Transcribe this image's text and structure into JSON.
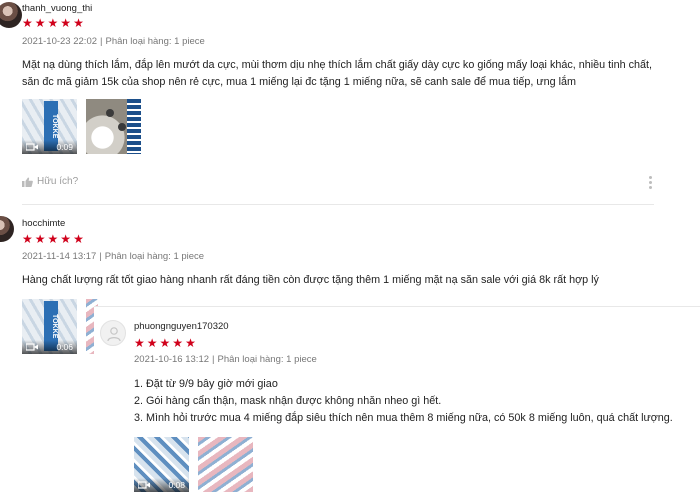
{
  "reviews": [
    {
      "username": "thanh_vuong_thi",
      "rating": 5,
      "date": "2021-10-23 22:02",
      "variation_label": "Phân loại hàng: 1 piece",
      "content": "Mặt nạ dùng thích lắm, đắp lên mướt da cực, mùi thơm dịu nhẹ thích lắm chất giấy dày cực ko giống mấy loại khác, nhiều tinh chất, săn đc mã giảm 15k của shop nên rẻ cực, mua 1 miếng lại đc tặng 1 miếng nữa, sẽ canh sale để mua tiếp, ưng lắm",
      "media": [
        {
          "type": "video",
          "duration": "0:09"
        },
        {
          "type": "image"
        }
      ],
      "helpful_label": "Hữu ích?"
    },
    {
      "username": "hocchimte",
      "rating": 5,
      "date": "2021-11-14 13:17",
      "variation_label": "Phân loại hàng: 1 piece",
      "content": "Hàng chất lượng rất tốt giao hàng nhanh rất đáng tiền còn được tặng thêm 1 miếng mặt nạ săn sale với giá 8k rất hợp lý",
      "media": [
        {
          "type": "video",
          "duration": "0:06"
        }
      ]
    },
    {
      "username": "phuongnguyen170320",
      "rating": 5,
      "date": "2021-10-16 13:12",
      "variation_label": "Phân loại hàng: 1 piece",
      "content_lines": [
        "1. Đặt từ 9/9 bây giờ mới giao",
        "2. Gói hàng cẩn thận, mask nhận được không nhăn nheo gì hết.",
        "3. Mình hỏi trước mua 4 miếng đắp siêu thích nên mua thêm 8 miếng nữa, có 50k 8 miếng luôn, quá chất lượng."
      ],
      "media": [
        {
          "type": "video",
          "duration": "0:08"
        },
        {
          "type": "image"
        }
      ]
    }
  ],
  "icons": {
    "star": "★",
    "thumbs_up": "thumbs-up-icon",
    "video": "video-camera-icon",
    "more": "more-vertical-icon"
  },
  "colors": {
    "star": "#d0011b",
    "meta_text": "rgba(0,0,0,.55)",
    "helpful_text": "rgba(0,0,0,.4)"
  }
}
